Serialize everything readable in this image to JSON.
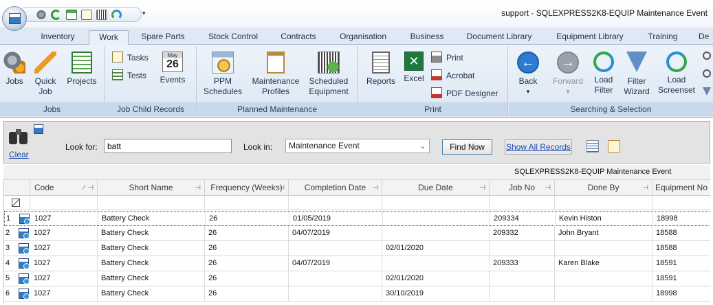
{
  "window": {
    "title": "support - SQLEXPRESS2K8-EQUIP Maintenance Event",
    "qat_dropdown": "▾"
  },
  "tabs": [
    {
      "label": "Inventory"
    },
    {
      "label": "Work",
      "active": true
    },
    {
      "label": "Spare Parts"
    },
    {
      "label": "Stock Control"
    },
    {
      "label": "Contracts"
    },
    {
      "label": "Organisation"
    },
    {
      "label": "Business"
    },
    {
      "label": "Document Library"
    },
    {
      "label": "Equipment Library"
    },
    {
      "label": "Training"
    },
    {
      "label": "De"
    }
  ],
  "ribbon": {
    "jobs": {
      "label": "Jobs",
      "jobs_btn": "Jobs",
      "quick_job_l1": "Quick",
      "quick_job_l2": "Job",
      "projects_btn": "Projects"
    },
    "child": {
      "label": "Job Child Records",
      "tasks": "Tasks",
      "tests": "Tests",
      "events": "Events",
      "cal_month": "May",
      "cal_day": "26"
    },
    "planned": {
      "label": "Planned Maintenance",
      "ppm_l1": "PPM",
      "ppm_l2": "Schedules",
      "mp_l1": "Maintenance",
      "mp_l2": "Profiles",
      "se_l1": "Scheduled",
      "se_l2": "Equipment"
    },
    "print": {
      "label": "Print",
      "reports": "Reports",
      "excel": "Excel",
      "print": "Print",
      "acrobat": "Acrobat",
      "pdf_designer": "PDF Designer"
    },
    "search": {
      "label": "Searching & Selection",
      "back": "Back",
      "forward": "Forward",
      "load_filter_l1": "Load",
      "load_filter_l2": "Filter",
      "filter_wizard_l1": "Filter",
      "filter_wizard_l2": "Wizard",
      "load_ss_l1": "Load",
      "load_ss_l2": "Screenset"
    }
  },
  "search_panel": {
    "clear": "Clear",
    "look_for_label": "Look for:",
    "look_for_value": "batt",
    "look_in_label": "Look in:",
    "look_in_value": "Maintenance Event",
    "find_now": "Find Now",
    "show_all": "Show All Records"
  },
  "grid": {
    "caption": "SQLEXPRESS2K8-EQUIP Maintenance Event",
    "columns": [
      "Code",
      "Short Name",
      "Frequency (Weeks)",
      "Completion Date",
      "Due Date",
      "Job No",
      "Done By",
      "Equipment No"
    ],
    "rows": [
      {
        "num": "1",
        "code": "1027",
        "short_name": "Battery Check",
        "frequency": "26",
        "completion": "01/05/2019",
        "due": "",
        "job_no": "209334",
        "done_by": "Kevin Histon",
        "equipment": "18998"
      },
      {
        "num": "2",
        "code": "1027",
        "short_name": "Battery Check",
        "frequency": "26",
        "completion": "04/07/2019",
        "due": "",
        "job_no": "209332",
        "done_by": "John Bryant",
        "equipment": "18588"
      },
      {
        "num": "3",
        "code": "1027",
        "short_name": "Battery Check",
        "frequency": "26",
        "completion": "",
        "due": "02/01/2020",
        "job_no": "",
        "done_by": "",
        "equipment": "18588"
      },
      {
        "num": "4",
        "code": "1027",
        "short_name": "Battery Check",
        "frequency": "26",
        "completion": "04/07/2019",
        "due": "",
        "job_no": "209333",
        "done_by": "Karen Blake",
        "equipment": "18591"
      },
      {
        "num": "5",
        "code": "1027",
        "short_name": "Battery Check",
        "frequency": "26",
        "completion": "",
        "due": "02/01/2020",
        "job_no": "",
        "done_by": "",
        "equipment": "18591"
      },
      {
        "num": "6",
        "code": "1027",
        "short_name": "Battery Check",
        "frequency": "26",
        "completion": "",
        "due": "30/10/2019",
        "job_no": "",
        "done_by": "",
        "equipment": "18998"
      }
    ]
  }
}
